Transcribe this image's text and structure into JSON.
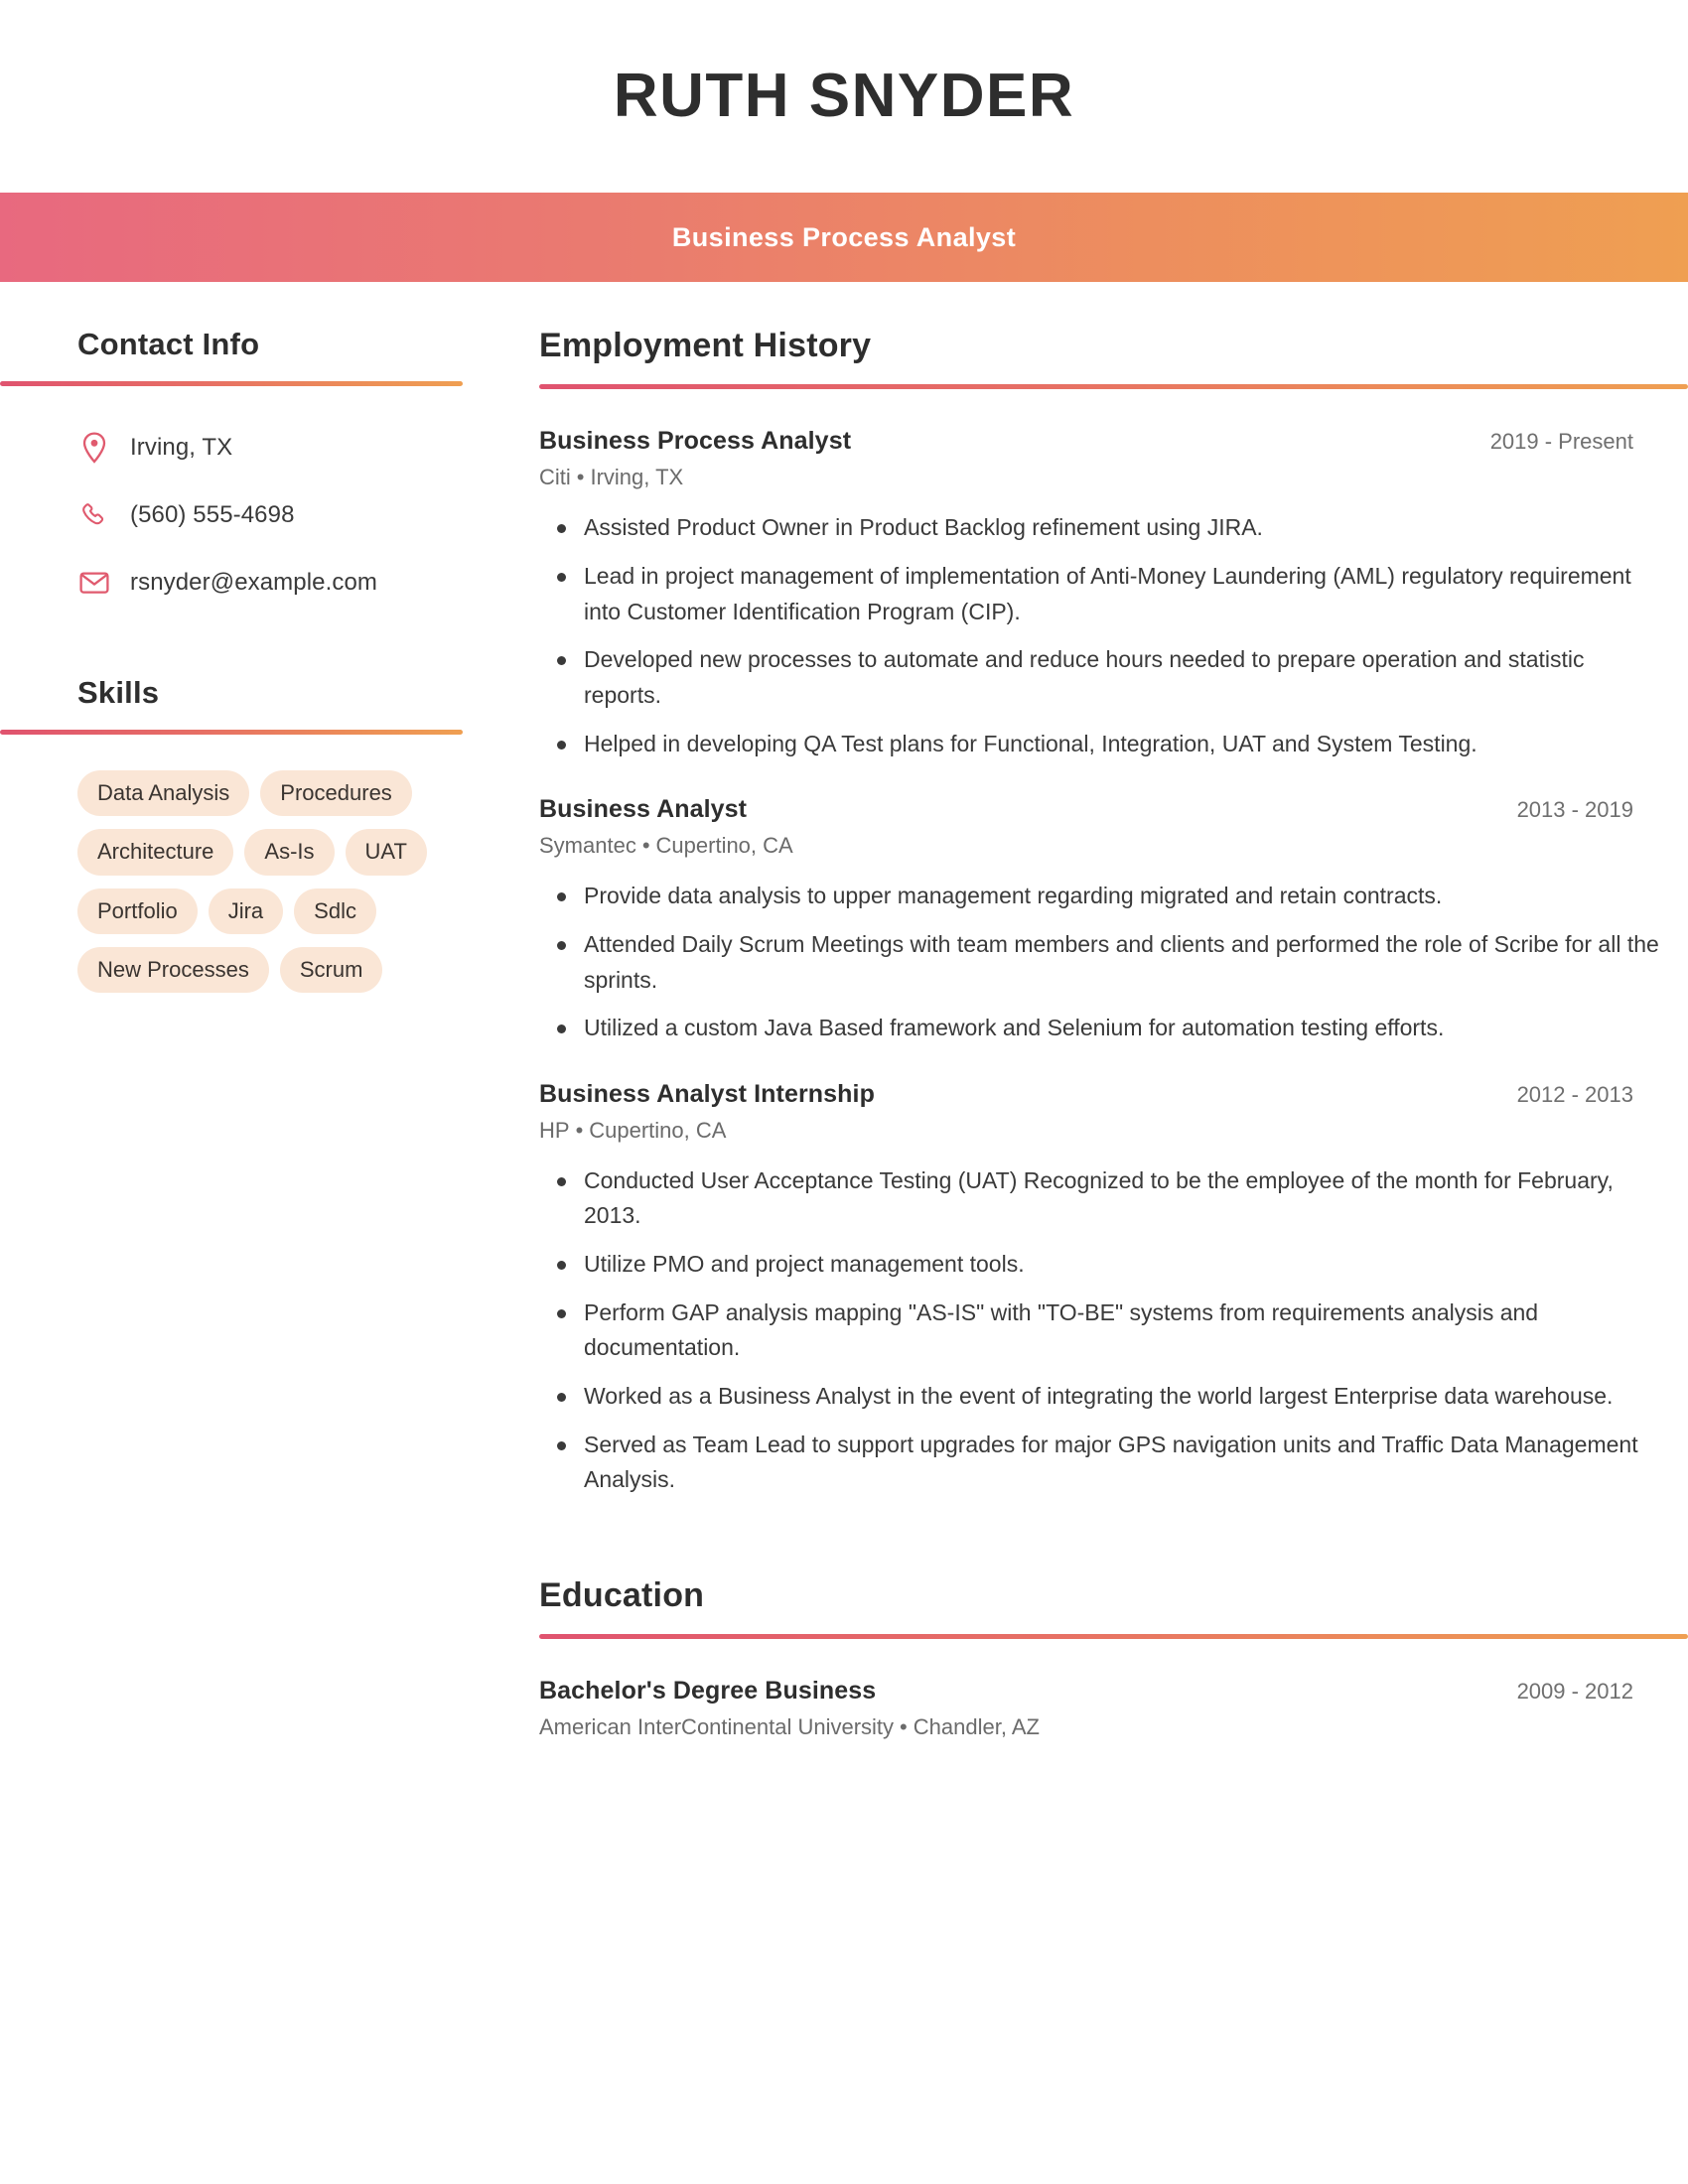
{
  "header": {
    "name": "RUTH SNYDER",
    "job_title": "Business Process Analyst",
    "gradient_start": "#e8697f",
    "gradient_end": "#ef9f52"
  },
  "sidebar": {
    "contact": {
      "heading": "Contact Info",
      "items": [
        {
          "icon": "location-pin-icon",
          "value": "Irving, TX"
        },
        {
          "icon": "phone-icon",
          "value": "(560) 555-4698"
        },
        {
          "icon": "envelope-icon",
          "value": "rsnyder@example.com"
        }
      ]
    },
    "skills": {
      "heading": "Skills",
      "pill_bg": "#fae6d6",
      "items": [
        "Data Analysis",
        "Procedures",
        "Architecture",
        "As-Is",
        "UAT",
        "Portfolio",
        "Jira",
        "Sdlc",
        "New Processes",
        "Scrum"
      ]
    }
  },
  "main": {
    "employment": {
      "heading": "Employment History",
      "jobs": [
        {
          "title": "Business Process Analyst",
          "dates": "2019 - Present",
          "company": "Citi",
          "location": "Irving, TX",
          "bullets": [
            "Assisted Product Owner in Product Backlog refinement using JIRA.",
            "Lead in project management of implementation of Anti-Money Laundering (AML) regulatory requirement into Customer Identification Program (CIP).",
            "Developed new processes to automate and reduce hours needed to prepare operation and statistic reports.",
            "Helped in developing QA Test plans for Functional, Integration, UAT and System Testing."
          ]
        },
        {
          "title": "Business Analyst",
          "dates": "2013 - 2019",
          "company": "Symantec",
          "location": "Cupertino, CA",
          "bullets": [
            "Provide data analysis to upper management regarding migrated and retain contracts.",
            "Attended Daily Scrum Meetings with team members and clients and performed the role of Scribe for all the sprints.",
            "Utilized a custom Java Based framework and Selenium for automation testing efforts."
          ]
        },
        {
          "title": "Business Analyst Internship",
          "dates": "2012 - 2013",
          "company": "HP",
          "location": "Cupertino, CA",
          "bullets": [
            "Conducted User Acceptance Testing (UAT) Recognized to be the employee of the month for February, 2013.",
            "Utilize PMO and project management tools.",
            "Perform GAP analysis mapping \"AS-IS\" with \"TO-BE\" systems from requirements analysis and documentation.",
            "Worked as a Business Analyst in the event of integrating the world largest Enterprise data warehouse.",
            "Served as Team Lead to support upgrades for major GPS navigation units and Traffic Data Management Analysis."
          ]
        }
      ]
    },
    "education": {
      "heading": "Education",
      "entries": [
        {
          "degree": "Bachelor's Degree Business",
          "dates": "2009 - 2012",
          "school": "American InterContinental University",
          "location": "Chandler, AZ"
        }
      ]
    }
  },
  "separator": "•"
}
